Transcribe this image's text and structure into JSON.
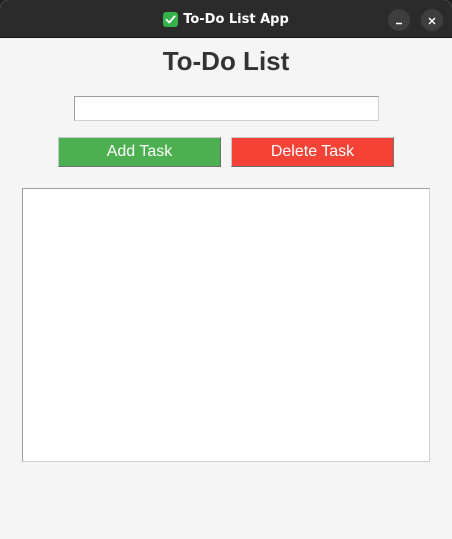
{
  "window": {
    "title": "To-Do List App",
    "title_icon": "check-mark-icon",
    "minimize_icon": "minimize-icon",
    "close_icon": "close-icon"
  },
  "main": {
    "heading": "To-Do List",
    "task_input": {
      "value": "",
      "placeholder": ""
    },
    "buttons": {
      "add_label": "Add Task",
      "delete_label": "Delete Task"
    },
    "task_list": {
      "items": []
    }
  },
  "colors": {
    "add_button": "#4caf50",
    "delete_button": "#f44336",
    "titlebar": "#2b2b2b",
    "background": "#f5f5f5"
  }
}
